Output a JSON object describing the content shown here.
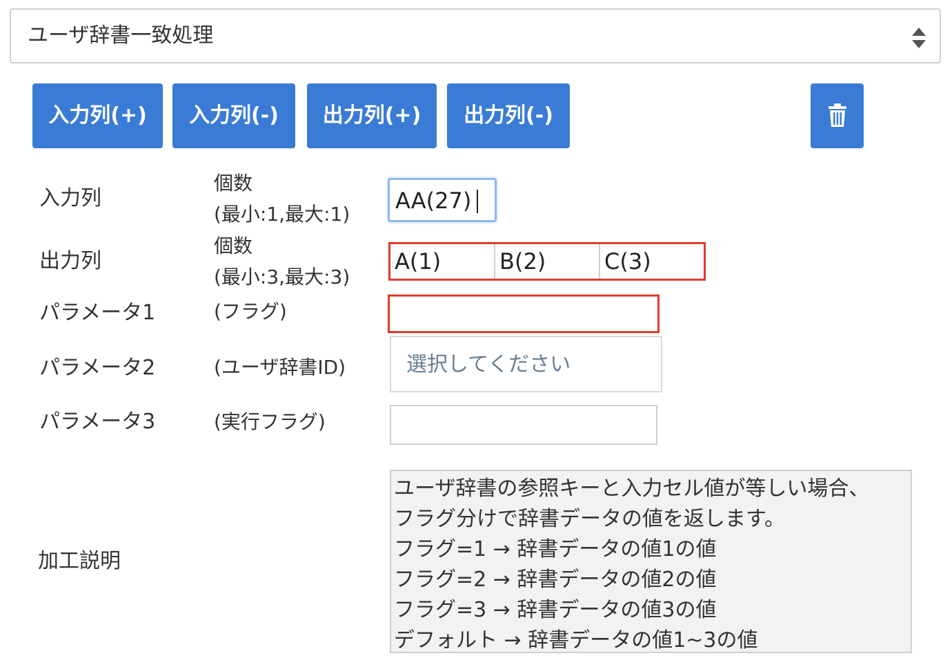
{
  "process_select": {
    "value": "ユーザ辞書一致処理",
    "icon": "updown-arrows-icon"
  },
  "toolbar": {
    "add_input": "入力列(+)",
    "remove_input": "入力列(-)",
    "add_output": "出力列(+)",
    "remove_output": "出力列(-)",
    "delete_icon": "trash-icon",
    "button_color": "#3a7bd5"
  },
  "input_column": {
    "label": "入力列",
    "count_label": "個数",
    "count_range": "(最小:1,最大:1)",
    "value": "AA(27)"
  },
  "output_column": {
    "label": "出力列",
    "count_label": "個数",
    "count_range": "(最小:3,最大:3)",
    "values": [
      "A(1)",
      "B(2)",
      "C(3)"
    ]
  },
  "params": [
    {
      "label": "パラメータ1",
      "hint": "(フラグ)",
      "value": ""
    },
    {
      "label": "パラメータ2",
      "hint": "(ユーザ辞書ID)",
      "placeholder": "選択してください"
    },
    {
      "label": "パラメータ3",
      "hint": "(実行フラグ)",
      "value": ""
    }
  ],
  "description": {
    "label": "加工説明",
    "lines": [
      "ユーザ辞書の参照キーと入力セル値が等しい場合、",
      "フラグ分けで辞書データの値を返します。",
      "フラグ=1 → 辞書データの値1の値",
      "フラグ=2 → 辞書データの値2の値",
      "フラグ=3 → 辞書データの値3の値",
      "デフォルト → 辞書データの値1~3の値"
    ]
  },
  "highlight_color": "#e0392f"
}
